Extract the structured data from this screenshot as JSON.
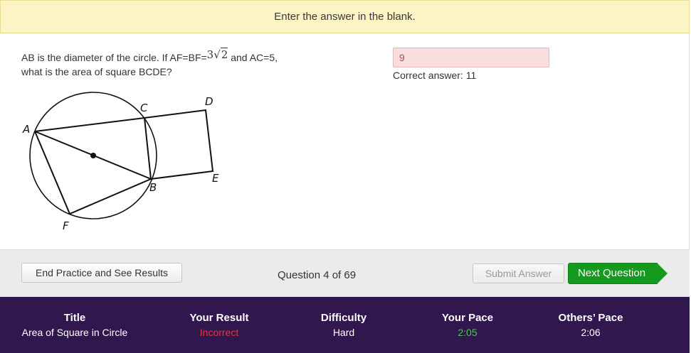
{
  "banner": {
    "text": "Enter the answer in the blank."
  },
  "question": {
    "line1_pre": "AB is the diameter of the circle. If AF=BF=",
    "coef": "3",
    "radical": "√",
    "radicand": "2",
    "line1_post": " and AC=5,",
    "line2": "what is the area of square BCDE?",
    "figure_labels": {
      "A": "A",
      "B": "B",
      "C": "C",
      "D": "D",
      "E": "E",
      "F": "F"
    }
  },
  "answer": {
    "value": "9",
    "correct_label": "Correct answer: 11"
  },
  "toolbar": {
    "end_label": "End Practice and See Results",
    "counter": "Question 4 of 69",
    "submit_label": "Submit Answer",
    "next_label": "Next Question"
  },
  "stats": {
    "title": {
      "label": "Title",
      "value": "Area of Square in Circle"
    },
    "result": {
      "label": "Your Result",
      "value": "Incorrect"
    },
    "difficulty": {
      "label": "Difficulty",
      "value": "Hard"
    },
    "pace": {
      "label": "Your Pace",
      "value": "2:05"
    },
    "others": {
      "label": "Others’ Pace",
      "value": "2:06"
    }
  },
  "colors": {
    "banner_bg": "#fcf4c4",
    "footer_bg": "#30174e",
    "next_green": "#159a1f",
    "incorrect_red": "#e8363c",
    "pace_green": "#4cc94c",
    "answer_bg": "#f8dede"
  }
}
